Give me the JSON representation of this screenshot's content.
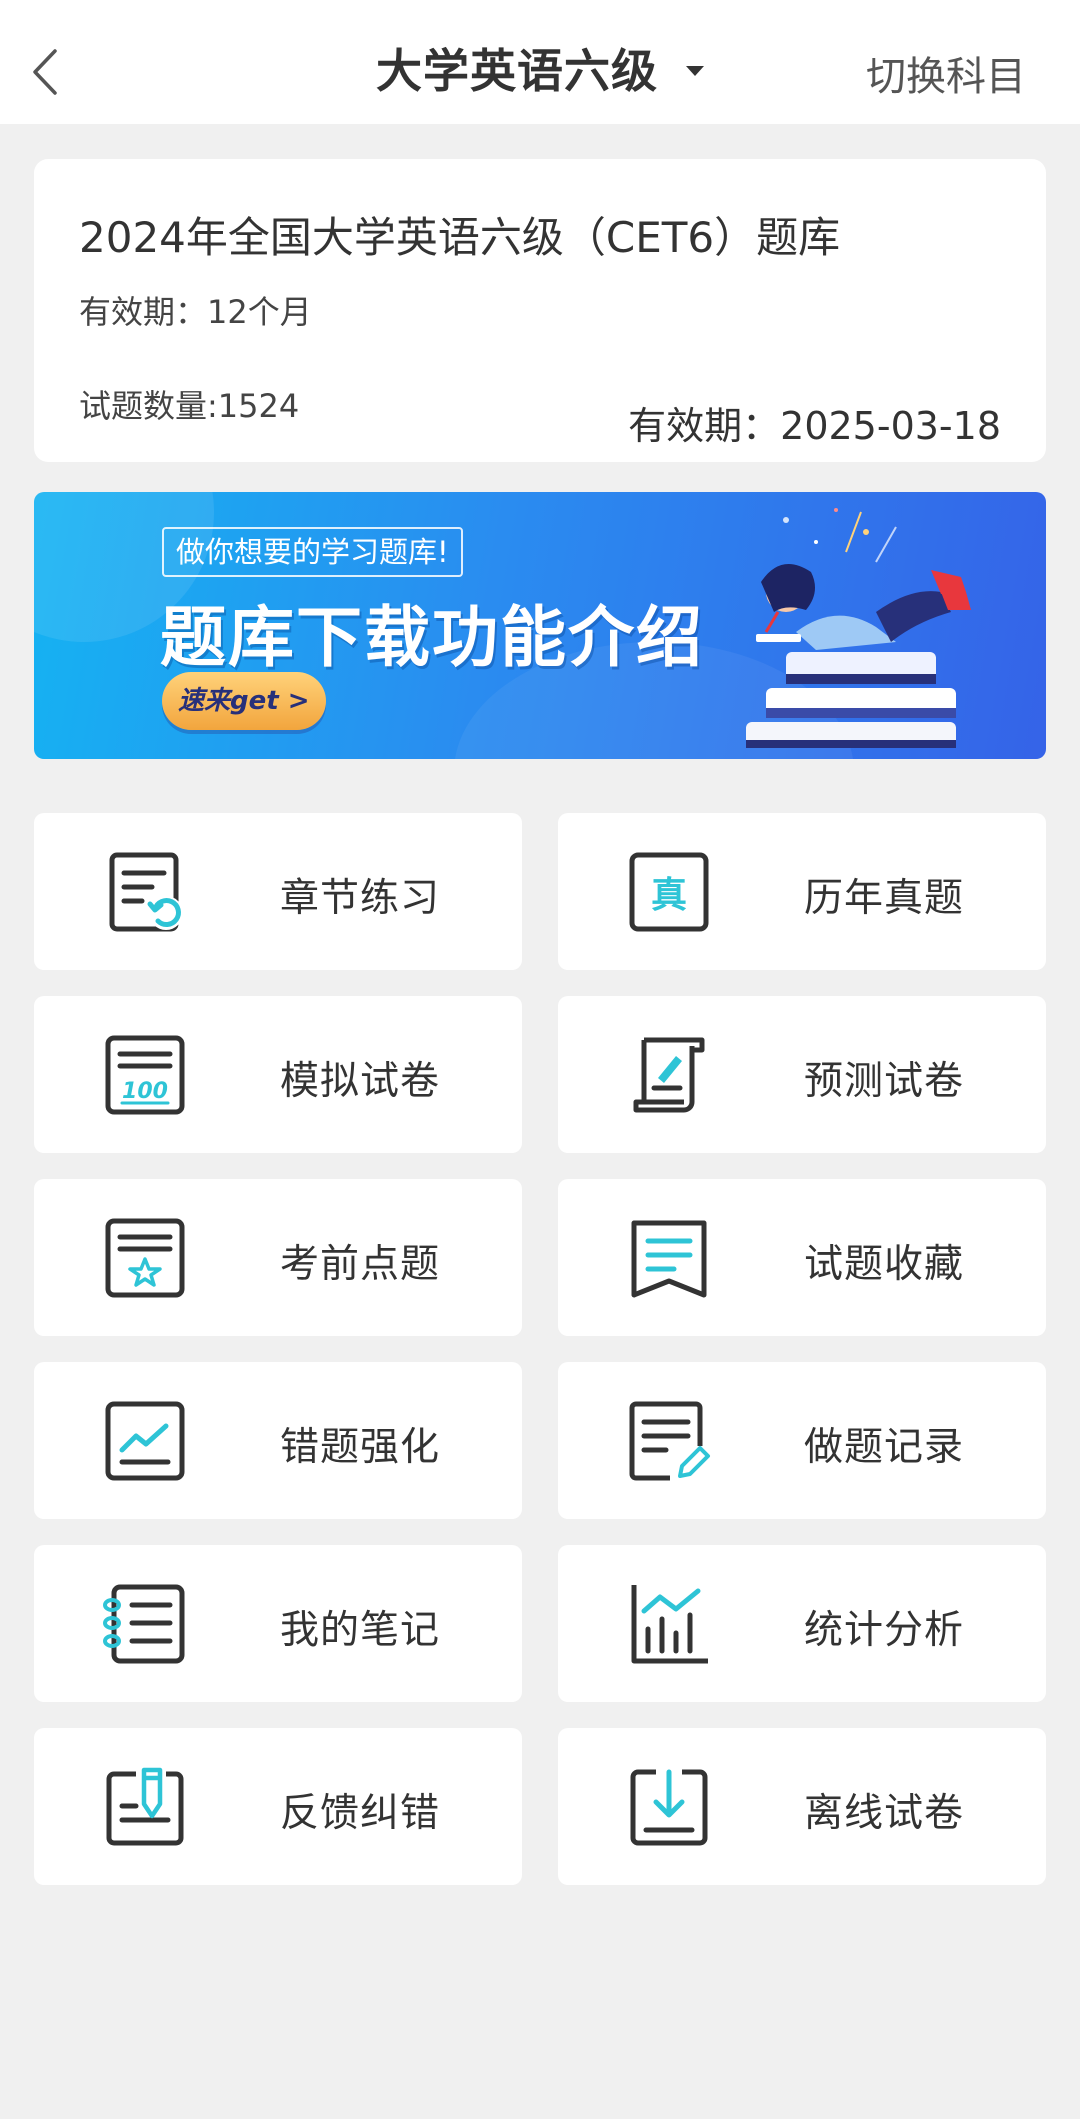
{
  "nav": {
    "title": "大学英语六级",
    "switch_label": "切换科目"
  },
  "info": {
    "title": "2024年全国大学英语六级（CET6）题库",
    "validity": "有效期：12个月",
    "count": "试题数量:1524",
    "expire": "有效期：2025-03-18"
  },
  "banner": {
    "tag": "做你想要的学习题库!",
    "headline": "题库下载功能介绍",
    "cta": "速来get >"
  },
  "menu": [
    {
      "label": "章节练习",
      "icon": "chapter-practice-icon"
    },
    {
      "label": "历年真题",
      "icon": "past-papers-icon"
    },
    {
      "label": "模拟试卷",
      "icon": "mock-exam-icon"
    },
    {
      "label": "预测试卷",
      "icon": "predicted-exam-icon"
    },
    {
      "label": "考前点题",
      "icon": "pre-exam-tips-icon"
    },
    {
      "label": "试题收藏",
      "icon": "bookmark-icon"
    },
    {
      "label": "错题强化",
      "icon": "wrong-questions-icon"
    },
    {
      "label": "做题记录",
      "icon": "practice-record-icon"
    },
    {
      "label": "我的笔记",
      "icon": "notes-icon"
    },
    {
      "label": "统计分析",
      "icon": "statistics-icon"
    },
    {
      "label": "反馈纠错",
      "icon": "feedback-icon"
    },
    {
      "label": "离线试卷",
      "icon": "offline-download-icon"
    }
  ],
  "colors": {
    "accent": "#2ec4d6",
    "icon_stroke": "#333333",
    "banner_start": "#15b3f2",
    "banner_end": "#3563e8"
  }
}
